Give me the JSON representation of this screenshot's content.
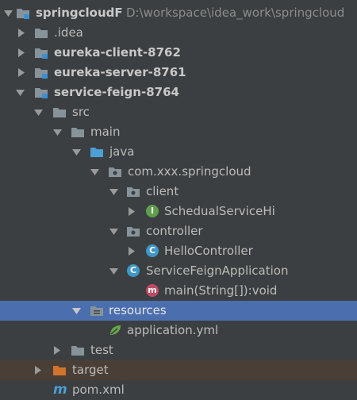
{
  "project": {
    "name": "springcloudF",
    "path": "D:\\workspace\\idea_work\\springcloud"
  },
  "tree": {
    "idea": ".idea",
    "eureka_client": "eureka-client-8762",
    "eureka_server": "eureka-server-8761",
    "service_feign": "service-feign-8764",
    "src": "src",
    "main": "main",
    "java": "java",
    "package": "com.xxx.springcloud",
    "client": "client",
    "schedual_service": "SchedualServiceHi",
    "controller": "controller",
    "hello_controller": "HelloController",
    "application_class": "ServiceFeignApplication",
    "main_method": "main(String[]):void",
    "resources": "resources",
    "application_yml": "application.yml",
    "test": "test",
    "target": "target",
    "pom": "pom.xml"
  },
  "icons": {
    "interface_badge": "I",
    "class_badge": "C",
    "method_badge": "m",
    "maven_glyph": "m"
  },
  "colors": {
    "background": "#3c3f41",
    "selection": "#4b6eaf",
    "excluded": "#4a3f36",
    "folder": "#87939a",
    "source_folder": "#4aa0d5",
    "target_folder": "#d0732c",
    "interface": "#5f9e4a",
    "class": "#3f97c8",
    "method": "#c04a63"
  }
}
